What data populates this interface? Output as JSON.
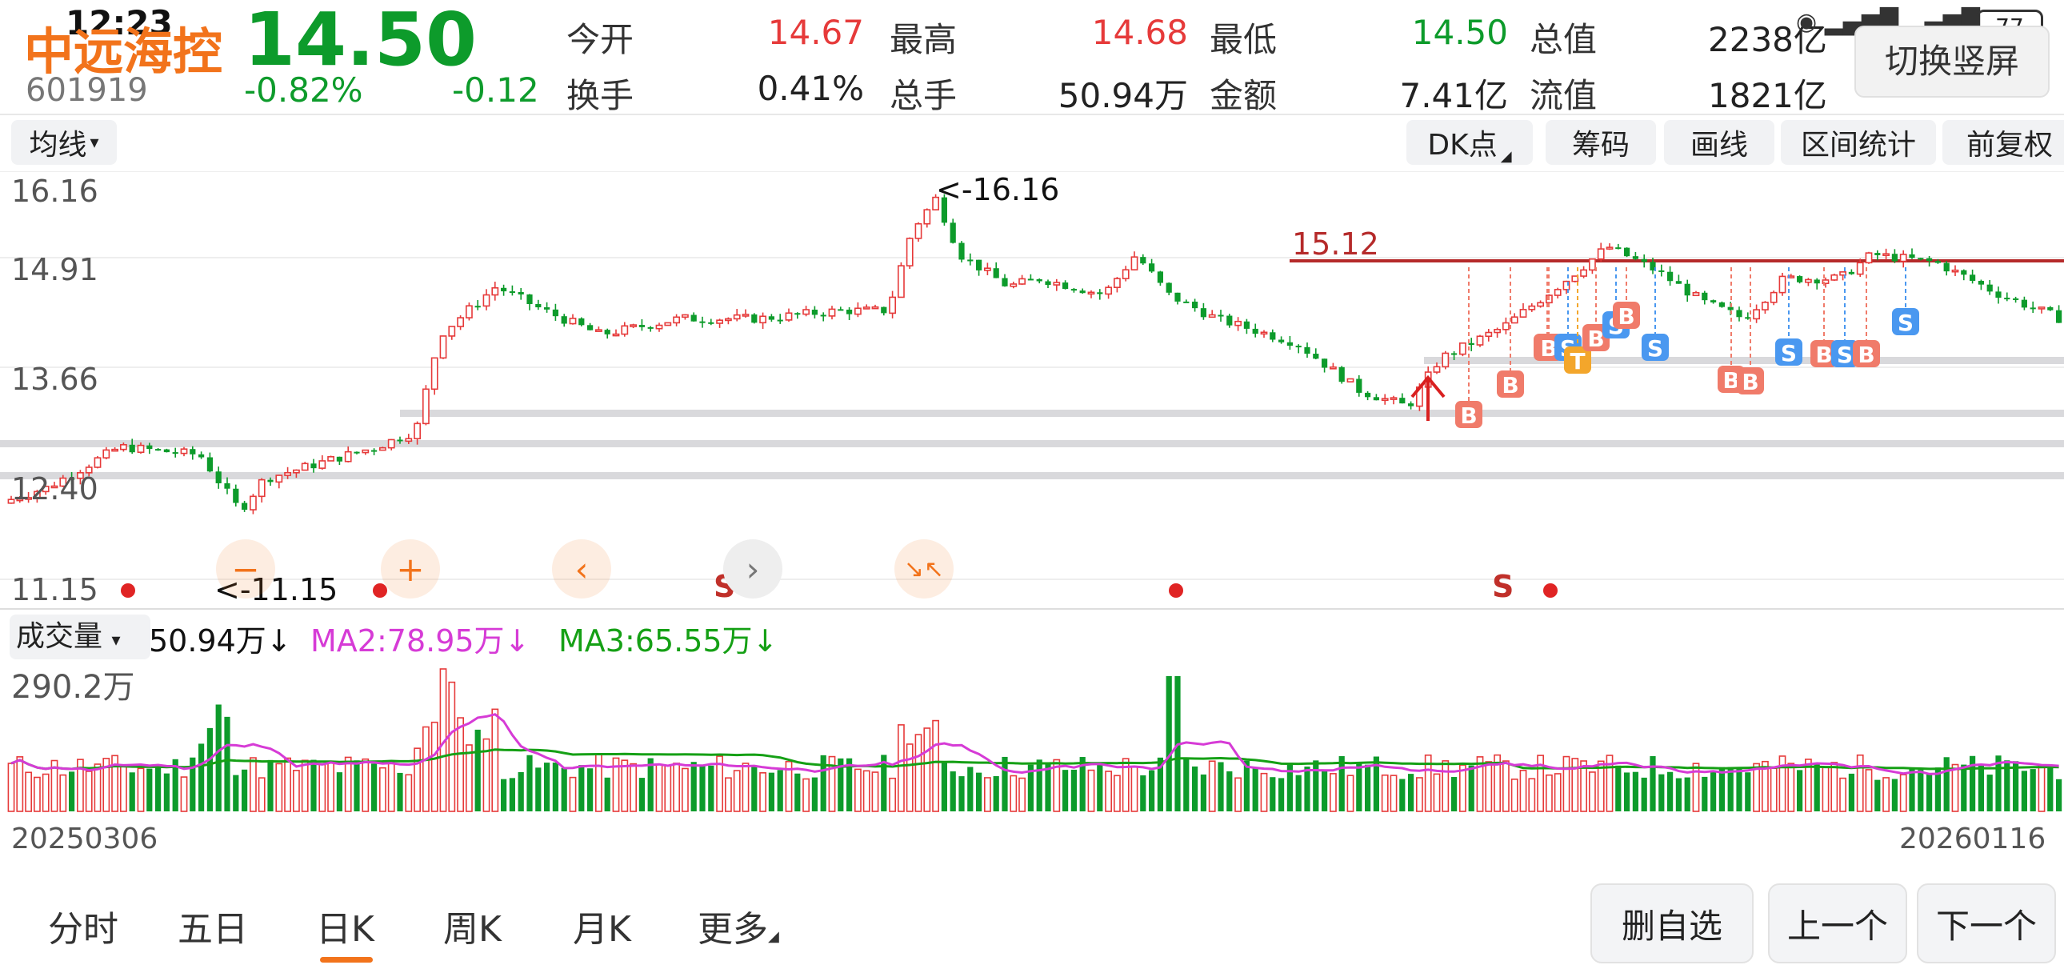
{
  "status_bar": {
    "time": "12:23",
    "battery": "77"
  },
  "stock": {
    "name": "中远海控",
    "code": "601919",
    "price": "14.50",
    "change_pct": "-0.82%",
    "change": "-0.12"
  },
  "quote": {
    "open_label": "今开",
    "open": "14.67",
    "high_label": "最高",
    "high": "14.68",
    "low_label": "最低",
    "low": "14.50",
    "mcap_label": "总值",
    "mcap": "2238亿",
    "turnover_label": "换手",
    "turnover": "0.41%",
    "volume_label": "总手",
    "volume": "50.94万",
    "amount_label": "金额",
    "amount": "7.41亿",
    "float_label": "流值",
    "float_cap": "1821亿"
  },
  "switch_portrait": "切换竖屏",
  "toolbar": {
    "ma_select": "均线",
    "dk": "DK点",
    "chips": "筹码",
    "draw": "画线",
    "range_stats": "区间统计",
    "adjust": "前复权"
  },
  "volume_panel": {
    "selector": "成交量",
    "vol": "50.94万↓",
    "ma2": "MA2:78.95万↓",
    "ma3": "MA3:65.55万↓",
    "max_label": "290.2万"
  },
  "chart_data": {
    "type": "candlestick",
    "y_ticks": [
      "16.16",
      "14.91",
      "13.66",
      "12.40",
      "11.15"
    ],
    "ylim": [
      11.15,
      16.16
    ],
    "max_annotation": "<-16.16",
    "min_annotation": "<-11.15",
    "level_line": "15.12",
    "x_start": "20250306",
    "x_end": "20260116",
    "signal_s": "S",
    "signal_b": "B",
    "signal_t": "T"
  },
  "tabs": [
    "分时",
    "五日",
    "日K",
    "周K",
    "月K",
    "更多"
  ],
  "active_tab": "日K",
  "bottom_buttons": {
    "remove": "删自选",
    "prev": "上一个",
    "next": "下一个"
  },
  "colors": {
    "up": "#e63a3a",
    "down": "#0d9b2b",
    "accent": "#f2731b",
    "ma2": "#d63bd6",
    "ma3": "#15a015"
  }
}
